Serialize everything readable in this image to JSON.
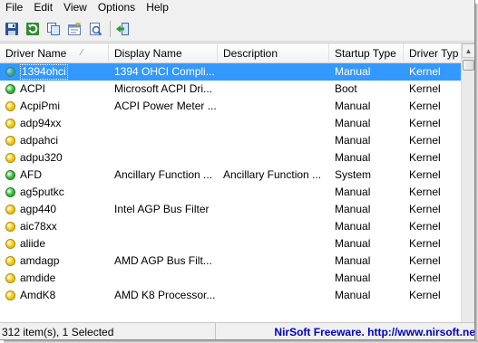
{
  "menu": [
    "File",
    "Edit",
    "View",
    "Options",
    "Help"
  ],
  "toolbar": {
    "buttons": [
      "save-icon",
      "refresh-icon",
      "copy-icon",
      "properties-icon",
      "html-report-icon",
      "exit-icon"
    ]
  },
  "columns": [
    {
      "label": "Driver Name"
    },
    {
      "label": "Display Name"
    },
    {
      "label": "Description"
    },
    {
      "label": "Startup Type"
    },
    {
      "label": "Driver Typ"
    }
  ],
  "status_colors": {
    "green": "#2fb52f",
    "yellow": "#f1c400",
    "selected_bg": "#3399ff"
  },
  "rows": [
    {
      "name": "1394ohci",
      "display": "1394 OHCI Compli...",
      "description": "",
      "startup": "Manual",
      "type": "Kernel",
      "status": "green",
      "selected": true
    },
    {
      "name": "ACPI",
      "display": "Microsoft ACPI Dri...",
      "description": "",
      "startup": "Boot",
      "type": "Kernel",
      "status": "green"
    },
    {
      "name": "AcpiPmi",
      "display": "ACPI Power Meter ...",
      "description": "",
      "startup": "Manual",
      "type": "Kernel",
      "status": "yellow"
    },
    {
      "name": "adp94xx",
      "display": "",
      "description": "",
      "startup": "Manual",
      "type": "Kernel",
      "status": "yellow"
    },
    {
      "name": "adpahci",
      "display": "",
      "description": "",
      "startup": "Manual",
      "type": "Kernel",
      "status": "yellow"
    },
    {
      "name": "adpu320",
      "display": "",
      "description": "",
      "startup": "Manual",
      "type": "Kernel",
      "status": "yellow"
    },
    {
      "name": "AFD",
      "display": "Ancillary Function ...",
      "description": "Ancillary Function ...",
      "startup": "System",
      "type": "Kernel",
      "status": "green"
    },
    {
      "name": "ag5putkc",
      "display": "",
      "description": "",
      "startup": "Manual",
      "type": "Kernel",
      "status": "green"
    },
    {
      "name": "agp440",
      "display": "Intel AGP Bus Filter",
      "description": "",
      "startup": "Manual",
      "type": "Kernel",
      "status": "yellow"
    },
    {
      "name": "aic78xx",
      "display": "",
      "description": "",
      "startup": "Manual",
      "type": "Kernel",
      "status": "yellow"
    },
    {
      "name": "aliide",
      "display": "",
      "description": "",
      "startup": "Manual",
      "type": "Kernel",
      "status": "yellow"
    },
    {
      "name": "amdagp",
      "display": "AMD AGP Bus Filt...",
      "description": "",
      "startup": "Manual",
      "type": "Kernel",
      "status": "yellow"
    },
    {
      "name": "amdide",
      "display": "",
      "description": "",
      "startup": "Manual",
      "type": "Kernel",
      "status": "yellow"
    },
    {
      "name": "AmdK8",
      "display": "AMD K8 Processor...",
      "description": "",
      "startup": "Manual",
      "type": "Kernel",
      "status": "yellow"
    }
  ],
  "status": {
    "left": "312 item(s), 1 Selected",
    "right": "NirSoft Freeware.  http://www.nirsoft.ne"
  }
}
